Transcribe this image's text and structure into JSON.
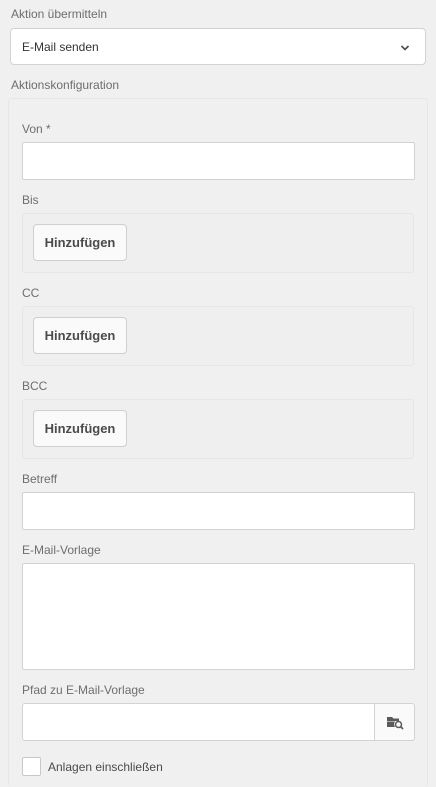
{
  "submit_action": {
    "label": "Aktion übermitteln",
    "selected": "E-Mail senden",
    "chevron_icon": "chevron-down-icon"
  },
  "config": {
    "title": "Aktionskonfiguration",
    "from": {
      "label": "Von *",
      "value": ""
    },
    "to": {
      "label": "Bis",
      "button": "Hinzufügen"
    },
    "cc": {
      "label": "CC",
      "button": "Hinzufügen"
    },
    "bcc": {
      "label": "BCC",
      "button": "Hinzufügen"
    },
    "subject": {
      "label": "Betreff",
      "value": ""
    },
    "template": {
      "label": "E-Mail-Vorlage",
      "value": ""
    },
    "template_path": {
      "label": "Pfad zu E-Mail-Vorlage",
      "value": "",
      "browse_icon": "folder-search-icon"
    },
    "attachments": {
      "label": "Anlagen einschließen",
      "checked": false
    }
  }
}
